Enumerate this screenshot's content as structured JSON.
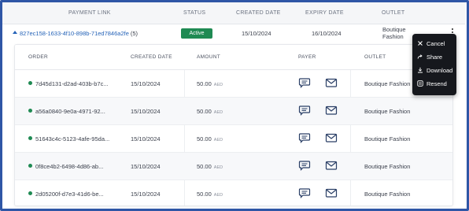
{
  "columns": {
    "payment_link": "PAYMENT LINK",
    "status": "STATUS",
    "created_date": "CREATED DATE",
    "expiry_date": "EXPIRY DATE",
    "outlet": "OUTLET"
  },
  "link_row": {
    "link": "827ec158-1633-4f10-898b-71ed7846a2fe",
    "count": "(5)",
    "status": "Active",
    "created": "15/10/2024",
    "expiry": "16/10/2024",
    "outlet_line1": "Boutique",
    "outlet_line2": "Fashion"
  },
  "orders": {
    "columns": {
      "order": "ORDER",
      "created_date": "CREATED DATE",
      "amount": "AMOUNT",
      "payer": "PAYER",
      "outlet": "OUTLET"
    },
    "rows": [
      {
        "order": "7d45d131-d2ad-403b-b7c...",
        "created": "15/10/2024",
        "amount": "50.00",
        "currency": "AED",
        "outlet": "Boutique Fashion"
      },
      {
        "order": "a56a0840-9e0a-4971-92...",
        "created": "15/10/2024",
        "amount": "50.00",
        "currency": "AED",
        "outlet": "Boutique Fashion"
      },
      {
        "order": "51643c4c-5123-4afe-95da...",
        "created": "15/10/2024",
        "amount": "50.00",
        "currency": "AED",
        "outlet": "Boutique Fashion"
      },
      {
        "order": "0f8ce4b2-6498-4d86-ab...",
        "created": "15/10/2024",
        "amount": "50.00",
        "currency": "AED",
        "outlet": "Boutique Fashion"
      },
      {
        "order": "2d05200f-d7e3-41d6-be...",
        "created": "15/10/2024",
        "amount": "50.00",
        "currency": "AED",
        "outlet": "Boutique Fashion"
      }
    ]
  },
  "menu": {
    "cancel": "Cancel",
    "share": "Share",
    "download": "Download",
    "resend": "Resend"
  },
  "icons": {
    "row_status": "green-dot-icon",
    "payer_sms": "chat-bubble-icon",
    "payer_email": "envelope-icon"
  },
  "colors": {
    "frame": "#2f56a6",
    "link": "#2563b8",
    "active": "#1f8a53",
    "menu_bg": "#16181d"
  }
}
